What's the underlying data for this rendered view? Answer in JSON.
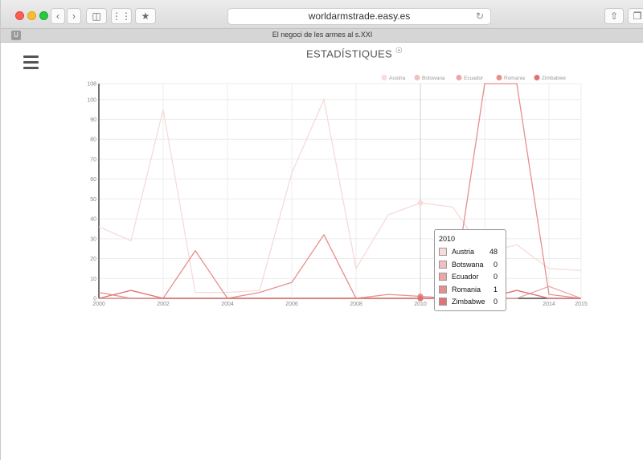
{
  "browser": {
    "url": "worldarmstrade.easy.es",
    "tab_title": "El negoci de les armes al s.XXI",
    "favicon_letter": "U"
  },
  "page": {
    "title": "ESTADÍSTIQUES"
  },
  "chart_data": {
    "type": "line",
    "x": [
      2000,
      2001,
      2002,
      2003,
      2004,
      2005,
      2006,
      2007,
      2008,
      2009,
      2010,
      2011,
      2012,
      2013,
      2014,
      2015
    ],
    "xticks": [
      2000,
      2002,
      2004,
      2006,
      2008,
      2010,
      2012,
      2014,
      2015
    ],
    "yticks": [
      0,
      10,
      20,
      30,
      40,
      50,
      60,
      70,
      80,
      90,
      100,
      108
    ],
    "ylim": [
      0,
      108
    ],
    "grid": true,
    "legend_position": "top-right",
    "series": [
      {
        "name": "Austria",
        "color": "#f7dada",
        "values": [
          36,
          29,
          95,
          3,
          3,
          4,
          63,
          100,
          15,
          42,
          48,
          46,
          23,
          27,
          15,
          14
        ]
      },
      {
        "name": "Botswana",
        "color": "#f2bfc0",
        "values": [
          0,
          0,
          0,
          0,
          0,
          0,
          0,
          0,
          0,
          0,
          0,
          0,
          0,
          4,
          0,
          0
        ]
      },
      {
        "name": "Ecuador",
        "color": "#eea5a5",
        "values": [
          0,
          0,
          0,
          0,
          0,
          0,
          0,
          0,
          0,
          0,
          0,
          0,
          0,
          0,
          6,
          0
        ]
      },
      {
        "name": "Romania",
        "color": "#e78e8e",
        "values": [
          3,
          0,
          0,
          24,
          0,
          3,
          8,
          32,
          0,
          2,
          1,
          0,
          108,
          108,
          2,
          0
        ]
      },
      {
        "name": "Zimbabwe",
        "color": "#df7272",
        "values": [
          0,
          4,
          0,
          0,
          0,
          0,
          0,
          0,
          0,
          0,
          0,
          0,
          0,
          4,
          0,
          0
        ]
      }
    ],
    "tooltip": {
      "year": "2010",
      "rows": [
        {
          "name": "Austria",
          "value": "48"
        },
        {
          "name": "Botswana",
          "value": "0"
        },
        {
          "name": "Ecuador",
          "value": "0"
        },
        {
          "name": "Romania",
          "value": "1"
        },
        {
          "name": "Zimbabwe",
          "value": "0"
        }
      ]
    }
  }
}
